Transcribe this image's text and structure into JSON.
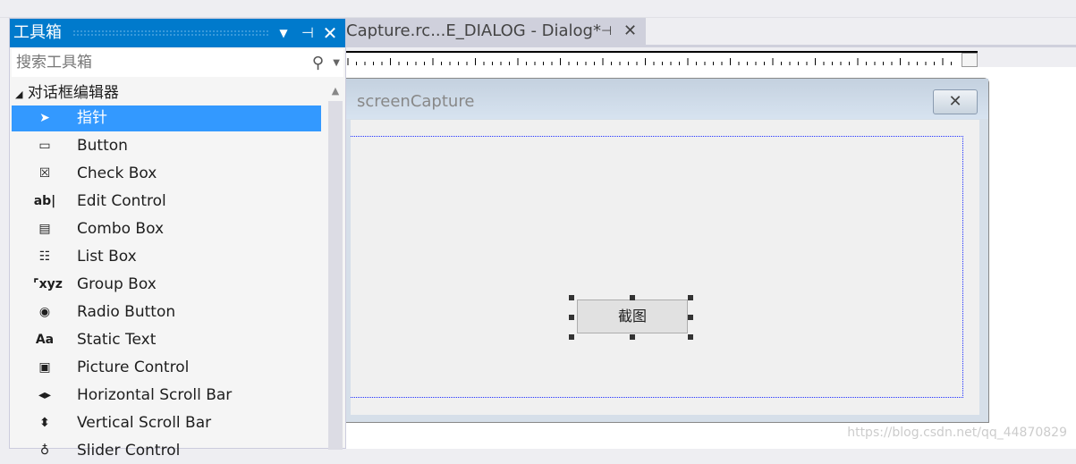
{
  "toolbox": {
    "title": "工具箱",
    "search_placeholder": "搜索工具箱",
    "group": "对话框编辑器",
    "items": [
      {
        "label": "指针",
        "icon": "pointer-icon",
        "glyph": "➤",
        "selected": true
      },
      {
        "label": "Button",
        "icon": "button-icon",
        "glyph": "▭"
      },
      {
        "label": "Check Box",
        "icon": "checkbox-icon",
        "glyph": "☒"
      },
      {
        "label": "Edit Control",
        "icon": "edit-control-icon",
        "glyph": "ab|"
      },
      {
        "label": "Combo Box",
        "icon": "combo-box-icon",
        "glyph": "▤"
      },
      {
        "label": "List Box",
        "icon": "list-box-icon",
        "glyph": "☷"
      },
      {
        "label": "Group Box",
        "icon": "group-box-icon",
        "glyph": "⌜xyz"
      },
      {
        "label": "Radio Button",
        "icon": "radio-button-icon",
        "glyph": "◉"
      },
      {
        "label": "Static Text",
        "icon": "static-text-icon",
        "glyph": "Aa"
      },
      {
        "label": "Picture Control",
        "icon": "picture-control-icon",
        "glyph": "▣"
      },
      {
        "label": "Horizontal Scroll Bar",
        "icon": "hscroll-icon",
        "glyph": "◂▸"
      },
      {
        "label": "Vertical Scroll Bar",
        "icon": "vscroll-icon",
        "glyph": "⬍"
      },
      {
        "label": "Slider Control",
        "icon": "slider-icon",
        "glyph": "♁"
      }
    ]
  },
  "editor": {
    "tab_label": "Capture.rc...E_DIALOG - Dialog*",
    "dialog_title": "screenCapture",
    "button_label": "截图"
  },
  "watermark": "https://blog.csdn.net/qq_44870829",
  "colors": {
    "accent": "#007acc",
    "selection": "#3399ff"
  }
}
